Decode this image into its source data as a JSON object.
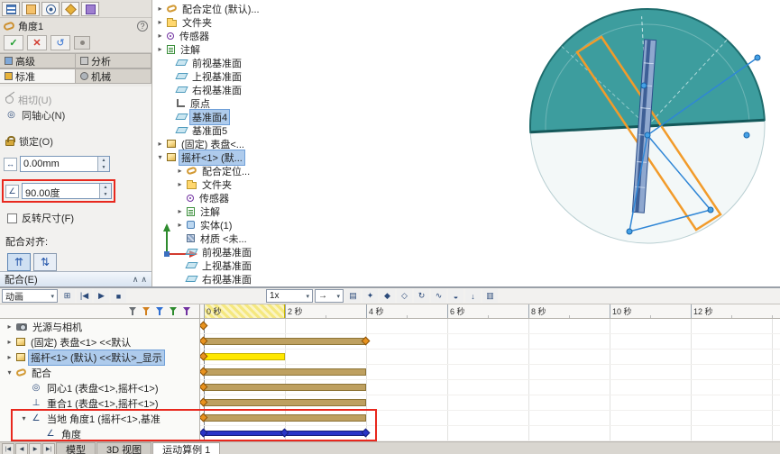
{
  "theme": {
    "accent_red": "#e8281e",
    "selection_blue": "#aecbec",
    "bar_khaki": "#bea060",
    "bar_khaki_border": "#8d7436",
    "bar_yellow": "#ffe800",
    "bar_yellow_border": "#c8b400",
    "bar_blue": "#2a35c8",
    "bar_blue_border": "#161f7a",
    "key_orange": "#e8921e",
    "key_orange_border": "#8a5208",
    "disc_teal": "#3d9d9e",
    "disc_edge": "#1e6c6d",
    "sketch_orange": "#f29b2a",
    "sketch_blue": "#2f86d6"
  },
  "glyphs": {
    "ok": "✓",
    "cancel": "✕",
    "undo": "↺",
    "help": "?",
    "dropdown": "▾",
    "collapse": "∧",
    "spin_up": "▲",
    "spin_down": "▼",
    "distance": "↔",
    "angle": "∠",
    "concentric": "◎",
    "coincident": "⊥",
    "align_same": "⇈",
    "align_opposite": "⇅",
    "calculate": "⊞",
    "play_from_start": "|◀",
    "play": "▶",
    "stop": "■",
    "mode_arrow": "→",
    "save": "▤",
    "wizard": "✦",
    "autokey": "◆",
    "addkey": "◇",
    "motor": "↻",
    "spring": "∿",
    "contact": "◒",
    "gravity": "↓",
    "results": "▥",
    "nav_first": "|◀",
    "nav_prev": "◀",
    "nav_next": "▶",
    "nav_last": "▶|"
  },
  "property_panel": {
    "title": "角度1",
    "tabs": [
      {
        "label": "高级"
      },
      {
        "label": "分析"
      },
      {
        "label": "标准"
      },
      {
        "label": "机械"
      }
    ],
    "mate_types": [
      {
        "label": "相切(U)"
      },
      {
        "label": "同轴心(N)"
      },
      {
        "label": "锁定(O)"
      }
    ],
    "distance_value": "0.00mm",
    "angle_value": "90.00度",
    "flip_label": "反转尺寸(F)",
    "alignment_label": "配合对齐:",
    "mates_header": "配合(E)"
  },
  "feature_tree": {
    "items": [
      {
        "label": "配合定位 (默认)...",
        "expand": "▸"
      },
      {
        "label": "文件夹",
        "expand": "▸"
      },
      {
        "label": "传感器",
        "expand": "▸"
      },
      {
        "label": "注解",
        "expand": "▸"
      },
      {
        "label": "前视基准面",
        "expand": ""
      },
      {
        "label": "上视基准面",
        "expand": ""
      },
      {
        "label": "右视基准面",
        "expand": ""
      },
      {
        "label": "原点",
        "expand": ""
      },
      {
        "label": "基准面4",
        "expand": ""
      },
      {
        "label": "基准面5",
        "expand": ""
      },
      {
        "label": "(固定) 表盘<...",
        "expand": "▸"
      },
      {
        "label": "摇杆<1> (默...",
        "expand": "▾"
      },
      {
        "label": "配合定位...",
        "expand": "▸"
      },
      {
        "label": "文件夹",
        "expand": "▸"
      },
      {
        "label": "传感器",
        "expand": ""
      },
      {
        "label": "注解",
        "expand": "▸"
      },
      {
        "label": "实体(1)",
        "expand": "▸"
      },
      {
        "label": "材质 <未...",
        "expand": ""
      },
      {
        "label": "前视基准面",
        "expand": ""
      },
      {
        "label": "上视基准面",
        "expand": ""
      },
      {
        "label": "右视基准面",
        "expand": ""
      }
    ]
  },
  "motion": {
    "toolbar": {
      "study_type": "动画",
      "speed": "1x"
    },
    "ruler_labels": [
      "0 秒",
      "2 秒",
      "4 秒",
      "6 秒",
      "8 秒",
      "10 秒",
      "12 秒"
    ],
    "seconds_per_division": 2,
    "rows": [
      {
        "label": "光源与相机",
        "expand": "▸",
        "keys": [
          0
        ],
        "bar": null
      },
      {
        "label": "(固定) 表盘<1> <<默认",
        "expand": "▸",
        "keys": [
          0,
          4
        ],
        "bar": {
          "start": 0,
          "end": 4
        }
      },
      {
        "label": "摇杆<1> (默认) <<默认>_显示",
        "expand": "▸",
        "keys": [
          0
        ],
        "bar": {
          "start": 0,
          "end": 2
        }
      },
      {
        "label": "配合",
        "expand": "▾",
        "keys": [
          0
        ],
        "bar": {
          "start": 0,
          "end": 4
        }
      },
      {
        "label": "同心1 (表盘<1>,摇杆<1>)",
        "expand": "",
        "keys": [
          0
        ],
        "bar": {
          "start": 0,
          "end": 4
        }
      },
      {
        "label": "重合1 (表盘<1>,摇杆<1>)",
        "expand": "",
        "keys": [
          0
        ],
        "bar": {
          "start": 0,
          "end": 4
        }
      },
      {
        "label": "当地 角度1 (摇杆<1>,基准",
        "expand": "▾",
        "keys": [
          0
        ],
        "bar": {
          "start": 0,
          "end": 4
        }
      },
      {
        "label": "角度",
        "expand": "",
        "keys": [
          0,
          2,
          4
        ],
        "bar": {
          "start": 0,
          "end": 4
        }
      }
    ],
    "bottom_tabs": [
      {
        "label": "模型"
      },
      {
        "label": "3D 视图"
      },
      {
        "label": "运动算例 1"
      }
    ]
  }
}
